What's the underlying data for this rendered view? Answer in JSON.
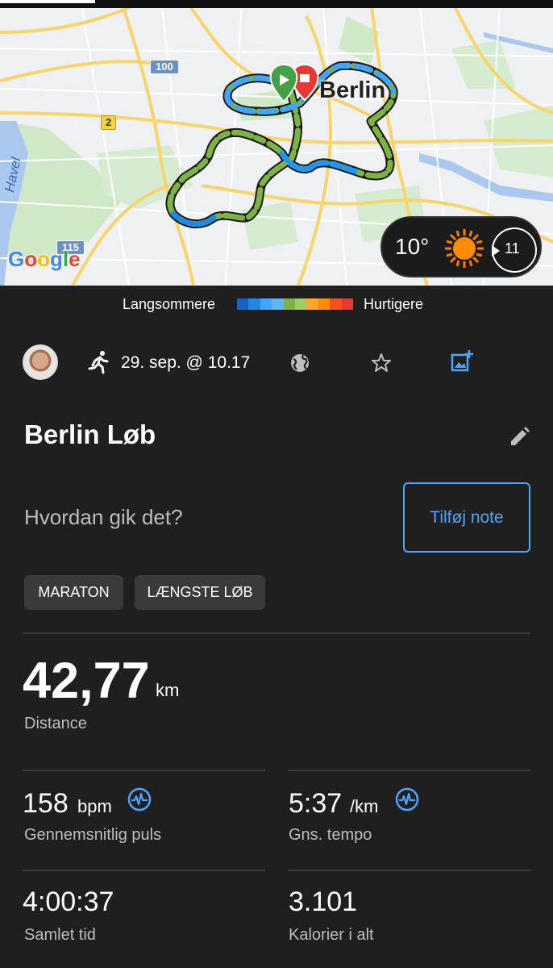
{
  "map": {
    "city_label": "Berlin",
    "water_label": "Havel",
    "shields": [
      "100",
      "2",
      "115"
    ],
    "attribution": [
      "G",
      "o",
      "o",
      "g",
      "l",
      "e"
    ],
    "attribution_colors": [
      "#4285F4",
      "#EA4335",
      "#FBBC05",
      "#4285F4",
      "#34A853",
      "#EA4335"
    ]
  },
  "weather": {
    "temperature": "10°",
    "condition_icon": "sun-icon",
    "wind_speed": "11"
  },
  "legend": {
    "slow_label": "Langsommere",
    "fast_label": "Hurtigere",
    "colors": [
      "#1565c0",
      "#1e88e5",
      "#42a5f5",
      "#64b5f6",
      "#7cb342",
      "#9ccc65",
      "#ffa726",
      "#fb8c00",
      "#f4511e",
      "#e53935"
    ]
  },
  "activity": {
    "type_icon": "running-icon",
    "date": "29. sep. @ 10.17",
    "title": "Berlin Løb",
    "note_prompt": "Hvordan gik det?",
    "note_button": "Tilføj note",
    "tags": [
      "MARATON",
      "LÆNGSTE LØB"
    ]
  },
  "stats": {
    "distance": {
      "value": "42,77",
      "unit": "km",
      "label": "Distance"
    },
    "heart_rate": {
      "value": "158",
      "unit": "bpm",
      "label": "Gennemsnitlig puls"
    },
    "pace": {
      "value": "5:37",
      "unit": "/km",
      "label": "Gns. tempo"
    },
    "total_time": {
      "value": "4:00:37",
      "label": "Samlet tid"
    },
    "calories": {
      "value": "3.101",
      "label": "Kalorier i alt"
    }
  },
  "colors": {
    "background": "#1f1f1f",
    "accent": "#4fa4ff",
    "tag_background": "#3a3a3a"
  }
}
